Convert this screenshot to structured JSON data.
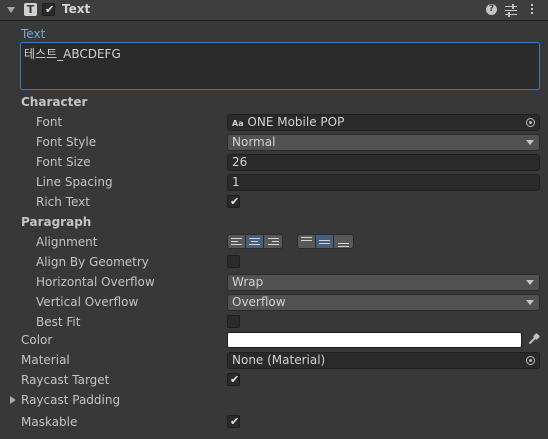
{
  "header": {
    "component_name": "Text",
    "enabled": true,
    "help_icon": "help-icon",
    "settings_icon": "preset-icon",
    "menu_icon": "kebab-menu-icon"
  },
  "text_area": {
    "label": "Text",
    "value": "테스트_ABCDEFG"
  },
  "character": {
    "heading": "Character",
    "font_label": "Font",
    "font_value": "ONE Mobile POP",
    "font_prefix": "Aa",
    "font_style_label": "Font Style",
    "font_style_value": "Normal",
    "font_size_label": "Font Size",
    "font_size_value": "26",
    "line_spacing_label": "Line Spacing",
    "line_spacing_value": "1",
    "rich_text_label": "Rich Text",
    "rich_text_checked": true
  },
  "paragraph": {
    "heading": "Paragraph",
    "alignment_label": "Alignment",
    "horizontal_selected": "center",
    "vertical_selected": "middle",
    "align_geometry_label": "Align By Geometry",
    "align_geometry_checked": false,
    "horizontal_overflow_label": "Horizontal Overflow",
    "horizontal_overflow_value": "Wrap",
    "vertical_overflow_label": "Vertical Overflow",
    "vertical_overflow_value": "Overflow",
    "best_fit_label": "Best Fit",
    "best_fit_checked": false
  },
  "color": {
    "label": "Color",
    "value": "#ffffff"
  },
  "material": {
    "label": "Material",
    "value": "None (Material)"
  },
  "raycast_target": {
    "label": "Raycast Target",
    "checked": true
  },
  "raycast_padding": {
    "label": "Raycast Padding"
  },
  "maskable": {
    "label": "Maskable",
    "checked": true
  },
  "colors": {
    "accent": "#7ba7d6",
    "focus_border": "#3a79bb",
    "panel": "#383838",
    "field": "#2a2a2a"
  }
}
